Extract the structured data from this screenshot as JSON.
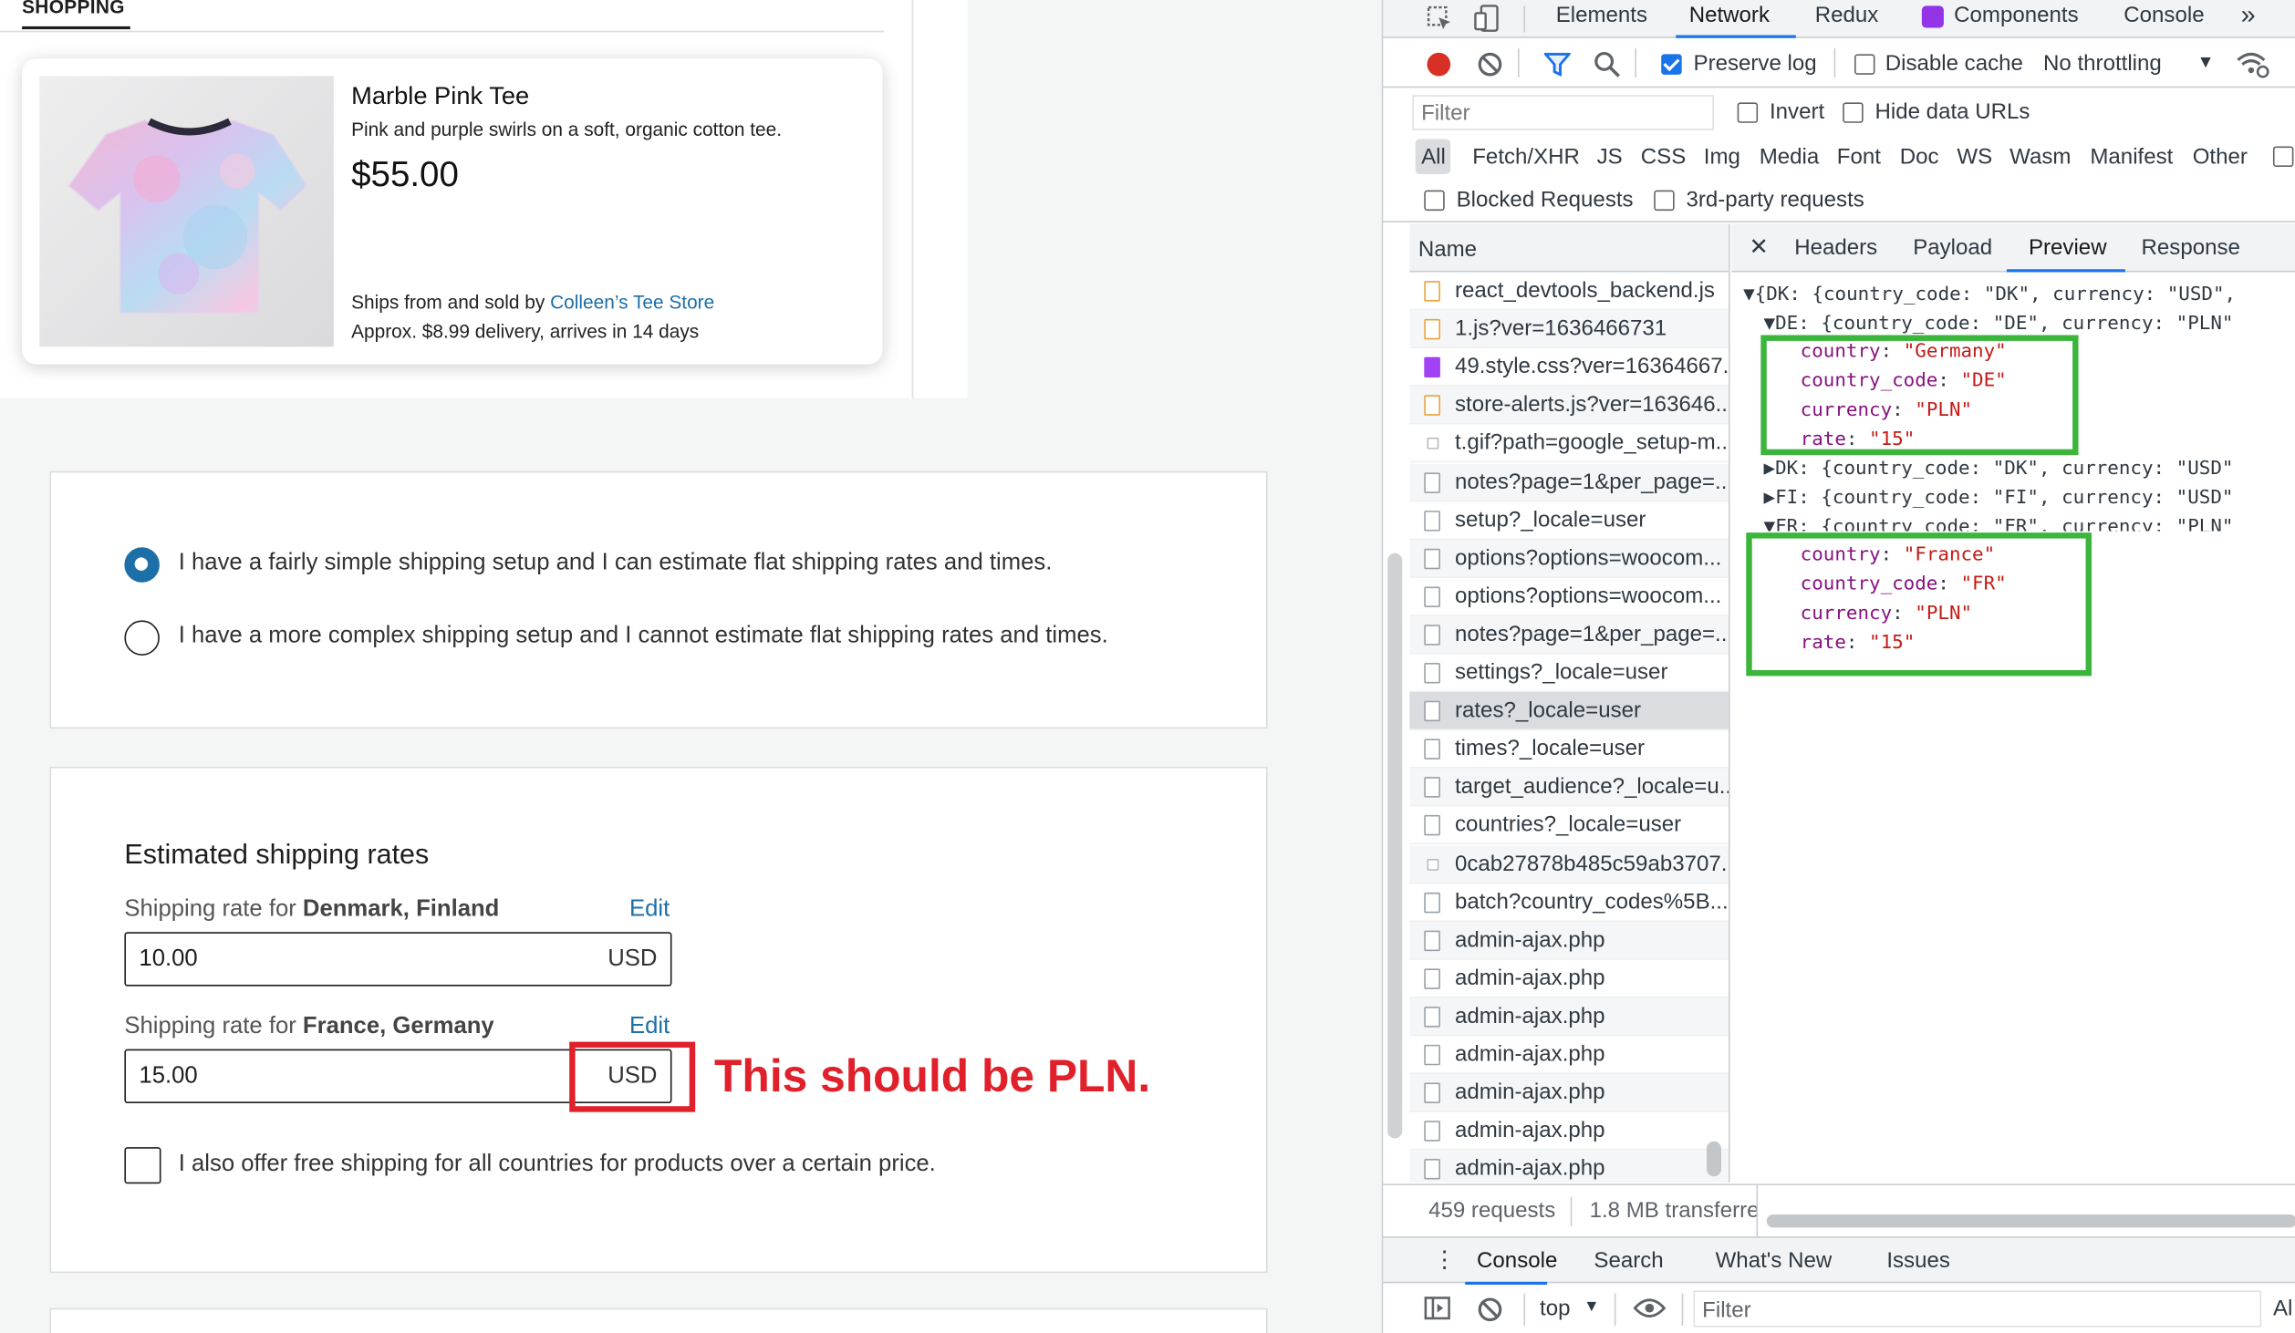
{
  "preview": {
    "tab_label": "SHOPPING",
    "product": {
      "title": "Marble Pink Tee",
      "description": "Pink and purple swirls on a soft, organic cotton tee.",
      "price": "$55.00",
      "ships_prefix": "Ships from and sold by ",
      "store_name": "Colleen’s Tee Store",
      "delivery": "Approx. $8.99 delivery, arrives in 14 days"
    }
  },
  "setup_options": [
    {
      "label": "I have a fairly simple shipping setup and I can estimate flat shipping rates and times.",
      "selected": true
    },
    {
      "label": "I have a more complex shipping setup and I cannot estimate flat shipping rates and times.",
      "selected": false
    }
  ],
  "estimated_rates": {
    "title": "Estimated shipping rates",
    "rows": [
      {
        "label_prefix": "Shipping rate for ",
        "countries": "Denmark, Finland",
        "edit": "Edit",
        "value": "10.00",
        "currency": "USD"
      },
      {
        "label_prefix": "Shipping rate for ",
        "countries": "France, Germany",
        "edit": "Edit",
        "value": "15.00",
        "currency": "USD"
      }
    ],
    "free_shipping_label": "I also offer free shipping for all countries for products over a certain price."
  },
  "annotation": {
    "note": "This should be PLN.",
    "color": "#e0202a"
  },
  "devtools": {
    "tabs": [
      "Elements",
      "Network",
      "Redux",
      "Components",
      "Console"
    ],
    "active_tab": "Network",
    "more": "»",
    "toolbar": {
      "preserve_log": "Preserve log",
      "disable_cache": "Disable cache",
      "throttling": "No throttling"
    },
    "filter": {
      "placeholder": "Filter",
      "invert": "Invert",
      "hide_data_urls": "Hide data URLs"
    },
    "types": [
      "All",
      "Fetch/XHR",
      "JS",
      "CSS",
      "Img",
      "Media",
      "Font",
      "Doc",
      "WS",
      "Wasm",
      "Manifest",
      "Other"
    ],
    "blocked_requests": "Blocked Requests",
    "third_party": "3rd-party requests",
    "name_header": "Name",
    "requests": [
      {
        "name": "react_devtools_backend.js",
        "icon": "js-file-icon"
      },
      {
        "name": "1.js?ver=1636466731",
        "icon": "js-file-icon"
      },
      {
        "name": "49.style.css?ver=16364667...",
        "icon": "css-file-icon"
      },
      {
        "name": "store-alerts.js?ver=163646...",
        "icon": "js-file-icon"
      },
      {
        "name": "t.gif?path=google_setup-m...",
        "icon": "image-file-icon"
      },
      {
        "name": "notes?page=1&per_page=...",
        "icon": "document-icon"
      },
      {
        "name": "setup?_locale=user",
        "icon": "document-icon"
      },
      {
        "name": "options?options=woocom...",
        "icon": "document-icon"
      },
      {
        "name": "options?options=woocom...",
        "icon": "document-icon"
      },
      {
        "name": "notes?page=1&per_page=...",
        "icon": "document-icon"
      },
      {
        "name": "settings?_locale=user",
        "icon": "document-icon"
      },
      {
        "name": "rates?_locale=user",
        "icon": "document-icon"
      },
      {
        "name": "times?_locale=user",
        "icon": "document-icon"
      },
      {
        "name": "target_audience?_locale=u...",
        "icon": "document-icon"
      },
      {
        "name": "countries?_locale=user",
        "icon": "document-icon"
      },
      {
        "name": "0cab27878b485c59ab3707...",
        "icon": "image-file-icon"
      },
      {
        "name": "batch?country_codes%5B...",
        "icon": "document-icon"
      },
      {
        "name": "admin-ajax.php",
        "icon": "document-icon"
      },
      {
        "name": "admin-ajax.php",
        "icon": "document-icon"
      },
      {
        "name": "admin-ajax.php",
        "icon": "document-icon"
      },
      {
        "name": "admin-ajax.php",
        "icon": "document-icon"
      },
      {
        "name": "admin-ajax.php",
        "icon": "document-icon"
      },
      {
        "name": "admin-ajax.php",
        "icon": "document-icon"
      },
      {
        "name": "admin-ajax.php",
        "icon": "document-icon"
      }
    ],
    "selected_request": "rates?_locale=user",
    "detail_tabs": [
      "Headers",
      "Payload",
      "Preview",
      "Response"
    ],
    "active_detail_tab": "Preview",
    "preview_lines": {
      "root": "{DK: {country_code: \"DK\", currency: \"USD\",",
      "de_summary": "DE: {country_code: \"DE\", currency: \"PLN\"",
      "de_fields": [
        {
          "key": "country",
          "value": "\"Germany\""
        },
        {
          "key": "country_code",
          "value": "\"DE\""
        },
        {
          "key": "currency",
          "value": "\"PLN\""
        },
        {
          "key": "rate",
          "value": "\"15\""
        }
      ],
      "dk_summary": "DK: {country_code: \"DK\", currency: \"USD\"",
      "fi_summary": "FI: {country_code: \"FI\", currency: \"USD\"",
      "fr_summary": "FR: {country_code: \"FR\", currency: \"PLN\"",
      "fr_fields": [
        {
          "key": "country",
          "value": "\"France\""
        },
        {
          "key": "country_code",
          "value": "\"FR\""
        },
        {
          "key": "currency",
          "value": "\"PLN\""
        },
        {
          "key": "rate",
          "value": "\"15\""
        }
      ]
    },
    "status": {
      "requests": "459 requests",
      "transferred": "1.8 MB transferre"
    },
    "drawer_tabs": [
      "Console",
      "Search",
      "What's New",
      "Issues"
    ],
    "console": {
      "context": "top",
      "filter_placeholder": "Filter",
      "level": "Al"
    },
    "highlight_color": "#3bb53b"
  }
}
